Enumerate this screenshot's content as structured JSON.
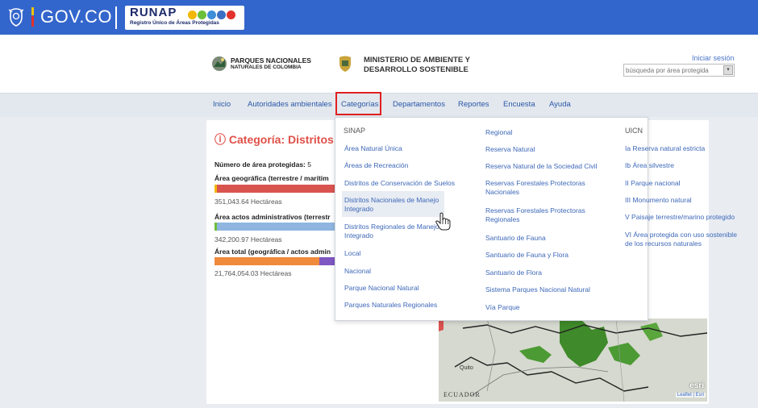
{
  "govbar": {
    "brand": "GOV.CO",
    "app_logo": "RUNAP",
    "app_subtitle": "Registro Único de Áreas Protegidas",
    "dot_colors": [
      "#f2b705",
      "#6bbf3a",
      "#3d8fd9",
      "#3a6fc4",
      "#e3322b"
    ]
  },
  "header": {
    "logo_pnn_line1": "PARQUES NACIONALES",
    "logo_pnn_line2": "NATURALES DE COLOMBIA",
    "logo_min_line1": "MINISTERIO DE AMBIENTE Y",
    "logo_min_line2": "DESARROLLO SOSTENIBLE",
    "login_link": "Iniciar sesión",
    "search_placeholder": "búsqueda por área protegida"
  },
  "nav": {
    "items": [
      "Inicio",
      "Autoridades ambientales",
      "Categorías",
      "Departamentos",
      "Reportes",
      "Encuesta",
      "Ayuda"
    ],
    "active": "Categorías"
  },
  "category_panel": {
    "title": "Categoría: Distritos Na",
    "count_label": "Número de área protegidas:",
    "count_value": "5",
    "stats": [
      {
        "label": "Área geográfica (terrestre / marítim",
        "value": "351,043.64 Hectáreas"
      },
      {
        "label": "Área actos administrativos (terrestr",
        "value": "342,200.97 Hectáreas"
      },
      {
        "label": "Área total (geográfica / actos admin",
        "value": "21,764,054.03 Hectáreas"
      }
    ]
  },
  "dropdown": {
    "col1": {
      "heading": "SINAP",
      "links": [
        "Área Natural Única",
        "Áreas de Recreación",
        "Distritos de Conservación de Suelos",
        "Distritos Nacionales de Manejo Integrado",
        "Distritos Regionales de Manejo Integrado",
        "Local",
        "Nacional",
        "Parque Nacional Natural",
        "Parques Naturales Regionales"
      ],
      "hovered": "Distritos Nacionales de Manejo Integrado"
    },
    "col2": {
      "heading": "Regional",
      "links": [
        "Reserva Natural",
        "Reserva Natural de la Sociedad Civil",
        "Reservas Forestales Protectoras Nacionales",
        "Reservas Forestales Protectoras Regionales",
        "Santuario de Fauna",
        "Santuario de Fauna y Flora",
        "Santuario de Flora",
        "Sistema Parques Nacional Natural",
        "Vía Parque"
      ]
    },
    "col3": {
      "heading": "UICN",
      "links": [
        "Ia Reserva natural estricta",
        "Ib Área silvestre",
        "II Parque nacional",
        "III Monumento natural",
        "V Paisaje terrestre/marino protegido",
        "VI Área protegida con uso sostenible de los recursos naturales"
      ]
    }
  },
  "map": {
    "label_country": "ECUADOR",
    "label_city": "Quito",
    "esri_badge": "esri",
    "attribution": "Leaflet | Esri"
  }
}
